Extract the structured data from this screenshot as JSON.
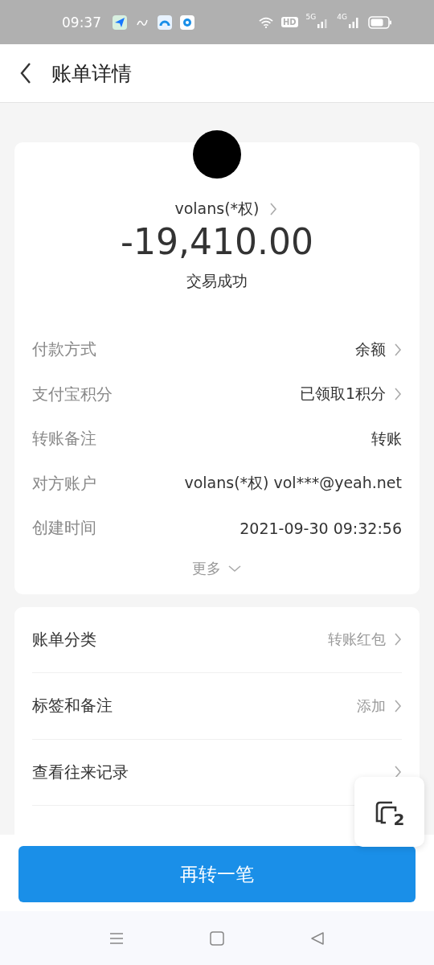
{
  "status_bar": {
    "time": "09:37",
    "hd": "HD",
    "net_1": "5G",
    "net_2": "4G"
  },
  "header": {
    "title": "账单详情"
  },
  "summary": {
    "payee": "volans(*权)",
    "amount": "-19,410.00",
    "status": "交易成功"
  },
  "details": [
    {
      "label": "付款方式",
      "value": "余额",
      "arrow": true
    },
    {
      "label": "支付宝积分",
      "value": "已领取1积分",
      "arrow": true
    },
    {
      "label": "转账备注",
      "value": "转账",
      "arrow": false
    },
    {
      "label": "对方账户",
      "value": "volans(*权) vol***@yeah.net",
      "arrow": false
    },
    {
      "label": "创建时间",
      "value": "2021-09-30 09:32:56",
      "arrow": false
    }
  ],
  "more": "更多",
  "menu": [
    {
      "label": "账单分类",
      "value": "转账红包"
    },
    {
      "label": "标签和备注",
      "value": "添加"
    },
    {
      "label": "查看往来记录"
    }
  ],
  "float_button": {
    "count": "2"
  },
  "action_button": "再转一笔"
}
